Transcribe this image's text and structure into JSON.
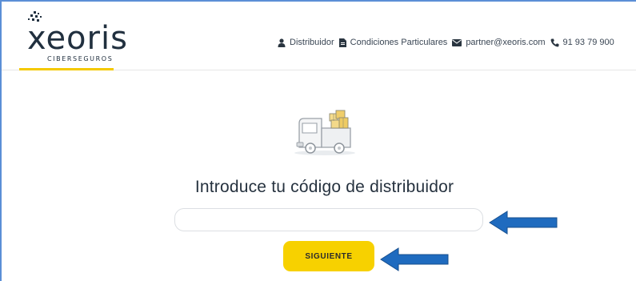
{
  "brand": {
    "name": "xeoris",
    "tagline": "CIBERSEGUROS",
    "accent_color": "#f7d100",
    "text_color": "#21303f"
  },
  "topnav": {
    "items": [
      {
        "label": "Distribuidor",
        "icon": "user-icon"
      },
      {
        "label": "Condiciones Particulares",
        "icon": "document-icon"
      },
      {
        "label": "partner@xeoris.com",
        "icon": "envelope-icon"
      },
      {
        "label": "91 93 79 900",
        "icon": "phone-icon"
      }
    ]
  },
  "main": {
    "illustration": "delivery-truck-icon",
    "title": "Introduce tu código de distribuidor",
    "code_input": {
      "value": "",
      "placeholder": ""
    },
    "next_button": {
      "label": "SIGUIENTE"
    }
  },
  "annotations": {
    "arrow_color": "#1f6bbf"
  }
}
